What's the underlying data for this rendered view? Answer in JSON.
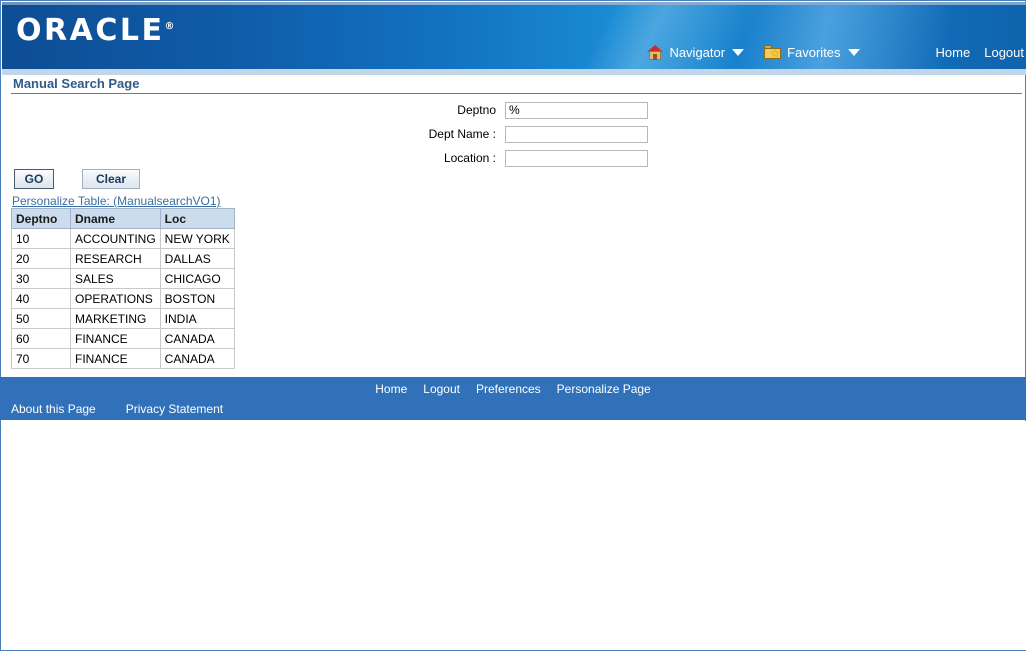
{
  "branding": {
    "logo_text": "ORACLE",
    "logo_registered": "®"
  },
  "global_nav": {
    "navigator": {
      "label": "Navigator",
      "icon": "house-icon"
    },
    "favorites": {
      "label": "Favorites",
      "icon": "folder-star-icon"
    },
    "links": [
      {
        "label": "Home"
      },
      {
        "label": "Logout"
      }
    ]
  },
  "page": {
    "title": "Manual Search Page"
  },
  "search_form": {
    "fields": [
      {
        "label": "Deptno",
        "value": "%",
        "placeholder": ""
      },
      {
        "label": "Dept Name :",
        "value": "",
        "placeholder": ""
      },
      {
        "label": "Location :",
        "value": "",
        "placeholder": ""
      }
    ],
    "buttons": {
      "go": "GO",
      "clear": "Clear"
    }
  },
  "personalize": {
    "link_text": "Personalize Table: (ManualsearchVO1)"
  },
  "results_table": {
    "columns": [
      "Deptno",
      "Dname",
      "Loc"
    ],
    "rows": [
      [
        "10",
        "ACCOUNTING",
        "NEW YORK"
      ],
      [
        "20",
        "RESEARCH",
        "DALLAS"
      ],
      [
        "30",
        "SALES",
        "CHICAGO"
      ],
      [
        "40",
        "OPERATIONS",
        "BOSTON"
      ],
      [
        "50",
        "MARKETING",
        "INDIA"
      ],
      [
        "60",
        "FINANCE",
        "CANADA"
      ],
      [
        "70",
        "FINANCE",
        "CANADA"
      ]
    ]
  },
  "footer": {
    "top_links": [
      {
        "label": "Home"
      },
      {
        "label": "Logout"
      },
      {
        "label": "Preferences"
      },
      {
        "label": "Personalize Page"
      }
    ],
    "bottom_links": [
      {
        "label": "About this Page"
      },
      {
        "label": "Privacy Statement"
      }
    ]
  },
  "colors": {
    "header_blue": "#1273c2",
    "footer_blue": "#3071b9",
    "title_text": "#315a89",
    "link_blue": "#3b6ea5",
    "table_header_bg": "#ccdcec",
    "page_border": "#4a7ebb"
  }
}
